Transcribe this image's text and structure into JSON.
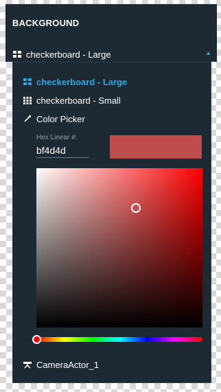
{
  "section": {
    "title": "BACKGROUND"
  },
  "background_select": {
    "value": "checkerboard - Large",
    "expanded": true,
    "icon": "grid-large-icon"
  },
  "options": [
    {
      "label": "checkerboard - Large",
      "icon": "grid-large-icon",
      "selected": true
    },
    {
      "label": "checkerboard - Small",
      "icon": "grid-small-icon",
      "selected": false
    },
    {
      "label": "Color Picker",
      "icon": "eyedropper-icon",
      "selected": false
    }
  ],
  "color_picker": {
    "hex_label": "Hex Linear #:",
    "hex_value": "bf4d4d",
    "swatch_color": "#bf4d4d",
    "hue_color": "#ff0000",
    "saturation": 0.6,
    "value": 0.75,
    "hue_fraction": 0.0
  },
  "camera_option": {
    "label": "CameraActor_1",
    "icon": "camera-icon"
  },
  "colors": {
    "accent": "#2ba8e0",
    "panel": "#1e2a33",
    "text": "#ffffff"
  }
}
